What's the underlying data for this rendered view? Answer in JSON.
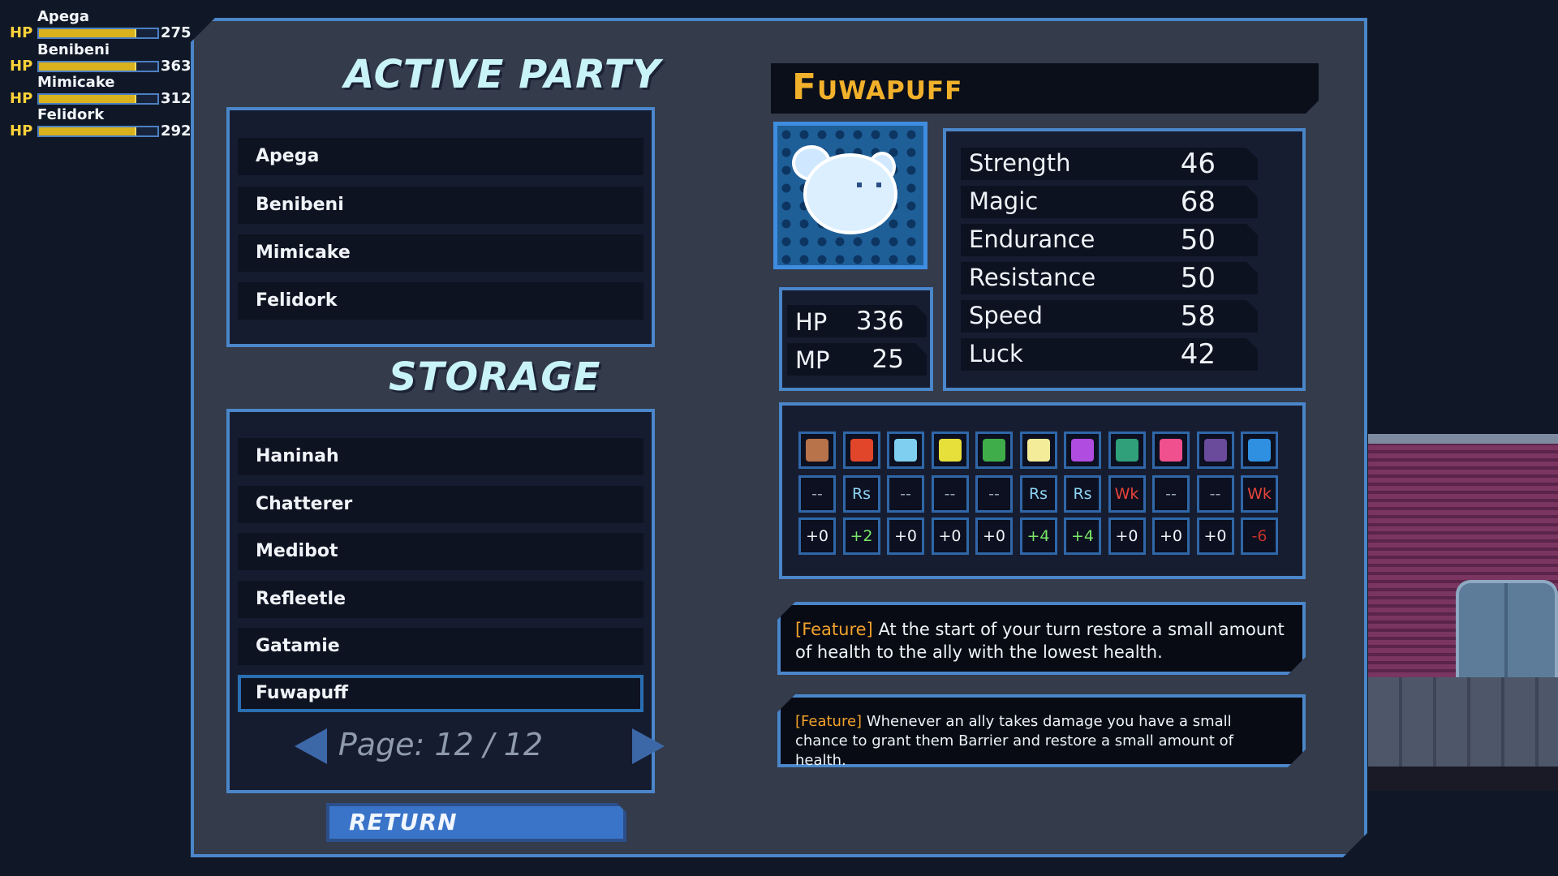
{
  "hud": {
    "members": [
      {
        "name": "Apega",
        "hp_label": "HP",
        "hp": "275",
        "hp_fraction": 0.82
      },
      {
        "name": "Benibeni",
        "hp_label": "HP",
        "hp": "363",
        "hp_fraction": 0.82
      },
      {
        "name": "Mimicake",
        "hp_label": "HP",
        "hp": "312",
        "hp_fraction": 0.82
      },
      {
        "name": "Felidork",
        "hp_label": "HP",
        "hp": "292",
        "hp_fraction": 0.82
      }
    ]
  },
  "active_party": {
    "heading": "ACTIVE PARTY",
    "members": [
      "Apega",
      "Benibeni",
      "Mimicake",
      "Felidork"
    ]
  },
  "storage": {
    "heading": "STORAGE",
    "members": [
      "Haninah",
      "Chatterer",
      "Medibot",
      "Refleetle",
      "Gatamie",
      "Fuwapuff"
    ],
    "selected_index": 5,
    "page_label": "Page: 12 / 12"
  },
  "return_label": "RETURN",
  "creature": {
    "name": "Fuwapuff",
    "hp_label": "HP",
    "hp": "336",
    "mp_label": "MP",
    "mp": "25",
    "stats": [
      {
        "label": "Strength",
        "value": "46"
      },
      {
        "label": "Magic",
        "value": "68"
      },
      {
        "label": "Endurance",
        "value": "50"
      },
      {
        "label": "Resistance",
        "value": "50"
      },
      {
        "label": "Speed",
        "value": "58"
      },
      {
        "label": "Luck",
        "value": "42"
      }
    ]
  },
  "affinities": {
    "icons": [
      "slash-icon",
      "fire-icon",
      "ice-icon",
      "thunder-icon",
      "wind-icon",
      "light-icon",
      "dark-icon",
      "poison-icon",
      "heart-icon",
      "earth-icon",
      "almighty-icon"
    ],
    "icon_colors": [
      "#b8734a",
      "#e2462a",
      "#7fd0f0",
      "#e8e03a",
      "#3fae4a",
      "#f5ec9a",
      "#b04ce0",
      "#2fa07a",
      "#f0508e",
      "#6a4a9a",
      "#2f8fe0"
    ],
    "resist": [
      "--",
      "Rs",
      "--",
      "--",
      "--",
      "Rs",
      "Rs",
      "Wk",
      "--",
      "--",
      "Wk"
    ],
    "resist_colors": [
      "#9aa6b6",
      "#8fd4f5",
      "#9aa6b6",
      "#9aa6b6",
      "#9aa6b6",
      "#8fd4f5",
      "#8fd4f5",
      "#e8443a",
      "#9aa6b6",
      "#9aa6b6",
      "#e8443a"
    ],
    "mods": [
      "+0",
      "+2",
      "+0",
      "+0",
      "+0",
      "+4",
      "+4",
      "+0",
      "+0",
      "+0",
      "-6"
    ],
    "mod_colors": [
      "#eef3f8",
      "#7be86a",
      "#eef3f8",
      "#eef3f8",
      "#eef3f8",
      "#7be86a",
      "#7be86a",
      "#eef3f8",
      "#eef3f8",
      "#eef3f8",
      "#c0332a"
    ]
  },
  "features": [
    {
      "tag": "[Feature]",
      "text": "At the start of your turn restore a small amount of health to the ally with the lowest health."
    },
    {
      "tag": "[Feature]",
      "text": "Whenever an ally takes damage you have a small chance to grant them Barrier and restore a small amount of health."
    }
  ]
}
